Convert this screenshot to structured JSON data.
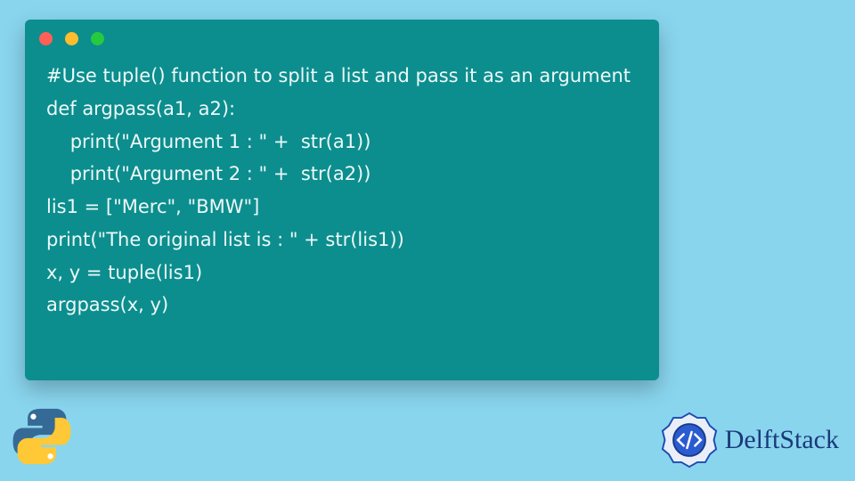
{
  "code": {
    "lines": [
      "#Use tuple() function to split a list and pass it as an argument",
      "def argpass(a1, a2):",
      "    print(\"Argument 1 : \" +  str(a1))",
      "    print(\"Argument 2 : \" +  str(a2))",
      "lis1 = [\"Merc\", \"BMW\"]",
      "print(\"The original list is : \" + str(lis1))",
      "x, y = tuple(lis1)",
      "argpass(x, y)"
    ]
  },
  "traffic": {
    "red": "#ff5f56",
    "yellow": "#ffbd2e",
    "green": "#27c93f"
  },
  "brand": {
    "name": "DelftStack"
  },
  "colors": {
    "page_bg": "#89d5ee",
    "window_bg": "#0c8e8e",
    "code_fg": "#eef8f8",
    "brand_fg": "#1a3a7a"
  }
}
